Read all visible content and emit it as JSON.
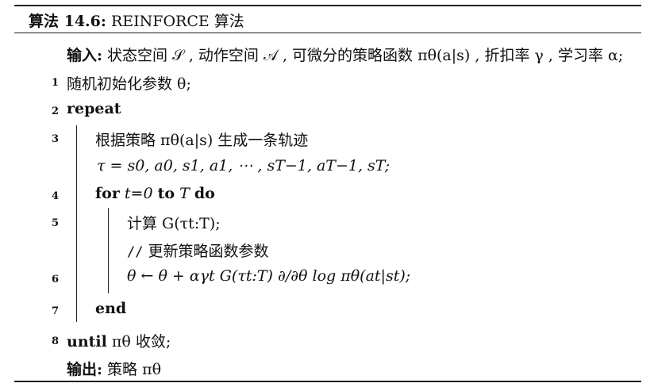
{
  "title": {
    "prefix": "算法 14.6:",
    "name": "REINFORCE 算法"
  },
  "lines": [
    {
      "num": "",
      "parts": [
        "输入:",
        " 状态空间 𝒮 , 动作空间 𝒜 , 可微分的策略函数 πθ(a|s) , 折扣率 γ , 学习率 α;"
      ]
    },
    {
      "num": "1",
      "text": "随机初始化参数 θ;"
    },
    {
      "num": "2",
      "text": "repeat"
    },
    {
      "num": "3",
      "text": "根据策略 πθ(a|s) 生成一条轨迹"
    },
    {
      "num": "",
      "text": "τ = s0, a0, s1, a1, ⋯ , sT−1, aT−1, sT;"
    },
    {
      "num": "4",
      "parts": [
        "for",
        " t=0 ",
        "to",
        " T ",
        "do"
      ]
    },
    {
      "num": "5",
      "text": "计算 G(τt:T);"
    },
    {
      "num": "",
      "parts": [
        "//",
        "  更新策略函数参数"
      ]
    },
    {
      "num": "6",
      "text": "θ ← θ + αγt G(τt:T) ∂/∂θ log πθ(at|st);"
    },
    {
      "num": "7",
      "text": "end"
    },
    {
      "num": "8",
      "parts": [
        "until",
        " πθ 收敛;"
      ]
    },
    {
      "num": "",
      "parts": [
        "输出:",
        " 策略 πθ"
      ]
    }
  ]
}
